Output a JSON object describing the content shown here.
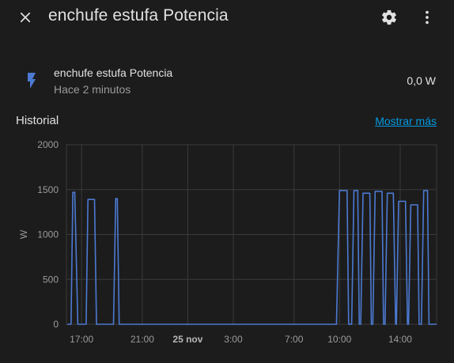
{
  "header": {
    "title": "enchufe estufa Potencia",
    "close_icon": "close-icon",
    "settings_icon": "gear-icon",
    "more_icon": "more-vertical-icon"
  },
  "entity": {
    "icon": "flash-icon",
    "name": "enchufe estufa Potencia",
    "last_changed": "Hace 2 minutos",
    "state": "0,0 W"
  },
  "history": {
    "title": "Historial",
    "more_link": "Mostrar más"
  },
  "colors": {
    "background": "#1c1c1c",
    "accent": "#039be5",
    "line": "#4c7ad2",
    "icon": "#4c7ad2"
  },
  "chart_data": {
    "type": "line",
    "title": "",
    "xlabel": "",
    "ylabel": "W",
    "ylim": [
      0,
      2000
    ],
    "yticks": [
      "2000",
      "1500",
      "1000",
      "500",
      "0"
    ],
    "xticks": [
      {
        "label": "17:00",
        "t": 17,
        "bold": false
      },
      {
        "label": "21:00",
        "t": 21,
        "bold": false
      },
      {
        "label": "25 nov",
        "t": 24,
        "bold": true
      },
      {
        "label": "3:00",
        "t": 27,
        "bold": false
      },
      {
        "label": "7:00",
        "t": 31,
        "bold": false
      },
      {
        "label": "10:00",
        "t": 34,
        "bold": false
      },
      {
        "label": "14:00",
        "t": 38,
        "bold": false
      }
    ],
    "xlim": [
      16.0,
      40.4
    ],
    "grid": true,
    "series": [
      {
        "name": "",
        "x": [
          16.05,
          16.3,
          16.42,
          16.55,
          16.75,
          17.3,
          17.42,
          17.85,
          17.98,
          19.1,
          19.25,
          19.35,
          19.48,
          33.8,
          34.0,
          34.5,
          34.6,
          34.8,
          34.95,
          35.2,
          35.3,
          35.4,
          35.55,
          36.0,
          36.1,
          36.2,
          36.35,
          36.8,
          36.9,
          37.0,
          37.15,
          37.55,
          37.7,
          37.75,
          37.9,
          38.35,
          38.48,
          38.55,
          38.7,
          39.15,
          39.25,
          39.4,
          39.55,
          39.8,
          39.9,
          40.4
        ],
        "y": [
          0,
          0,
          1470,
          1470,
          0,
          0,
          1390,
          1390,
          0,
          0,
          1400,
          1400,
          0,
          0,
          1490,
          1490,
          0,
          0,
          1490,
          1490,
          0,
          0,
          1460,
          1460,
          0,
          0,
          1480,
          1480,
          0,
          0,
          1460,
          1460,
          0,
          0,
          1370,
          1370,
          0,
          0,
          1330,
          1330,
          0,
          0,
          1490,
          1490,
          0,
          0
        ]
      }
    ]
  }
}
